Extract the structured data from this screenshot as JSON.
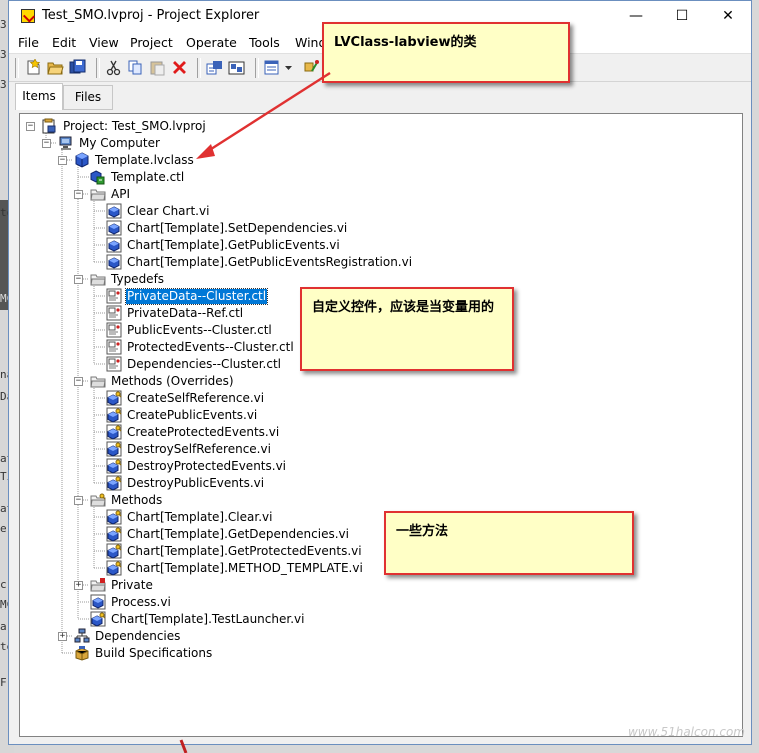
{
  "window": {
    "title": "Test_SMO.lvproj - Project Explorer",
    "minimize_glyph": "—",
    "maximize_glyph": "☐",
    "close_glyph": "✕"
  },
  "menu": [
    "File",
    "Edit",
    "View",
    "Project",
    "Operate",
    "Tools",
    "Wind"
  ],
  "tabs": [
    {
      "label": "Items",
      "active": true
    },
    {
      "label": "Files",
      "active": false
    }
  ],
  "tree": [
    {
      "label": "Project: Test_SMO.lvproj",
      "depth": 0,
      "icon": "project-icon",
      "expander": "-"
    },
    {
      "label": "My Computer",
      "depth": 1,
      "icon": "computer-icon",
      "expander": "-"
    },
    {
      "label": "Template.lvclass",
      "depth": 2,
      "icon": "lvclass-icon",
      "expander": "-"
    },
    {
      "label": "Template.ctl",
      "depth": 3,
      "icon": "class-ctl-icon",
      "expander": ""
    },
    {
      "label": "API",
      "depth": 3,
      "icon": "folder-icon",
      "expander": "-"
    },
    {
      "label": "Clear Chart.vi",
      "depth": 4,
      "icon": "vi-icon",
      "expander": ""
    },
    {
      "label": "Chart[Template].SetDependencies.vi",
      "depth": 4,
      "icon": "vi-icon",
      "expander": ""
    },
    {
      "label": "Chart[Template].GetPublicEvents.vi",
      "depth": 4,
      "icon": "vi-icon",
      "expander": ""
    },
    {
      "label": "Chart[Template].GetPublicEventsRegistration.vi",
      "depth": 4,
      "icon": "vi-icon",
      "expander": ""
    },
    {
      "label": "Typedefs",
      "depth": 3,
      "icon": "folder-icon",
      "expander": "-"
    },
    {
      "label": "PrivateData--Cluster.ctl",
      "depth": 4,
      "icon": "ctl-icon",
      "expander": "",
      "selected": true
    },
    {
      "label": "PrivateData--Ref.ctl",
      "depth": 4,
      "icon": "ctl-icon",
      "expander": ""
    },
    {
      "label": "PublicEvents--Cluster.ctl",
      "depth": 4,
      "icon": "ctl-icon",
      "expander": ""
    },
    {
      "label": "ProtectedEvents--Cluster.ctl",
      "depth": 4,
      "icon": "ctl-icon",
      "expander": ""
    },
    {
      "label": "Dependencies--Cluster.ctl",
      "depth": 4,
      "icon": "ctl-icon",
      "expander": ""
    },
    {
      "label": "Methods (Overrides)",
      "depth": 3,
      "icon": "folder-icon",
      "expander": "-"
    },
    {
      "label": "CreateSelfReference.vi",
      "depth": 4,
      "icon": "vi-key-icon",
      "expander": ""
    },
    {
      "label": "CreatePublicEvents.vi",
      "depth": 4,
      "icon": "vi-key-icon",
      "expander": ""
    },
    {
      "label": "CreateProtectedEvents.vi",
      "depth": 4,
      "icon": "vi-key-icon",
      "expander": ""
    },
    {
      "label": "DestroySelfReference.vi",
      "depth": 4,
      "icon": "vi-key-icon",
      "expander": ""
    },
    {
      "label": "DestroyProtectedEvents.vi",
      "depth": 4,
      "icon": "vi-key-icon",
      "expander": ""
    },
    {
      "label": "DestroyPublicEvents.vi",
      "depth": 4,
      "icon": "vi-key-icon",
      "expander": ""
    },
    {
      "label": "Methods",
      "depth": 3,
      "icon": "folder-key-icon",
      "expander": "-"
    },
    {
      "label": "Chart[Template].Clear.vi",
      "depth": 4,
      "icon": "vi-key-icon",
      "expander": ""
    },
    {
      "label": "Chart[Template].GetDependencies.vi",
      "depth": 4,
      "icon": "vi-key-icon",
      "expander": ""
    },
    {
      "label": "Chart[Template].GetProtectedEvents.vi",
      "depth": 4,
      "icon": "vi-key-icon",
      "expander": ""
    },
    {
      "label": "Chart[Template].METHOD_TEMPLATE.vi",
      "depth": 4,
      "icon": "vi-key-icon",
      "expander": ""
    },
    {
      "label": "Private",
      "depth": 3,
      "icon": "folder-private-icon",
      "expander": "+"
    },
    {
      "label": "Process.vi",
      "depth": 3,
      "icon": "vi-icon",
      "expander": ""
    },
    {
      "label": "Chart[Template].TestLauncher.vi",
      "depth": 3,
      "icon": "vi-key-icon",
      "expander": ""
    },
    {
      "label": "Dependencies",
      "depth": 2,
      "icon": "dependencies-icon",
      "expander": "+"
    },
    {
      "label": "Build Specifications",
      "depth": 2,
      "icon": "build-spec-icon",
      "expander": ""
    }
  ],
  "callouts": [
    {
      "text": "LVClass-labview的类"
    },
    {
      "text": "自定义控件，应该是当变量用的"
    },
    {
      "text": "一些方法"
    }
  ],
  "watermark": "www.51halcon.com",
  "backdrop_glyphs": [
    "3",
    "3",
    "3",
    "to",
    "MC",
    "na",
    "Da",
    "at",
    "Ti",
    "at",
    "er",
    "c",
    "MC",
    "a",
    "te",
    "F"
  ],
  "colors": {
    "selection": "#0078d7",
    "callout_fill": "#ffffc6",
    "callout_border": "#e03131",
    "arrow": "#e03131"
  }
}
